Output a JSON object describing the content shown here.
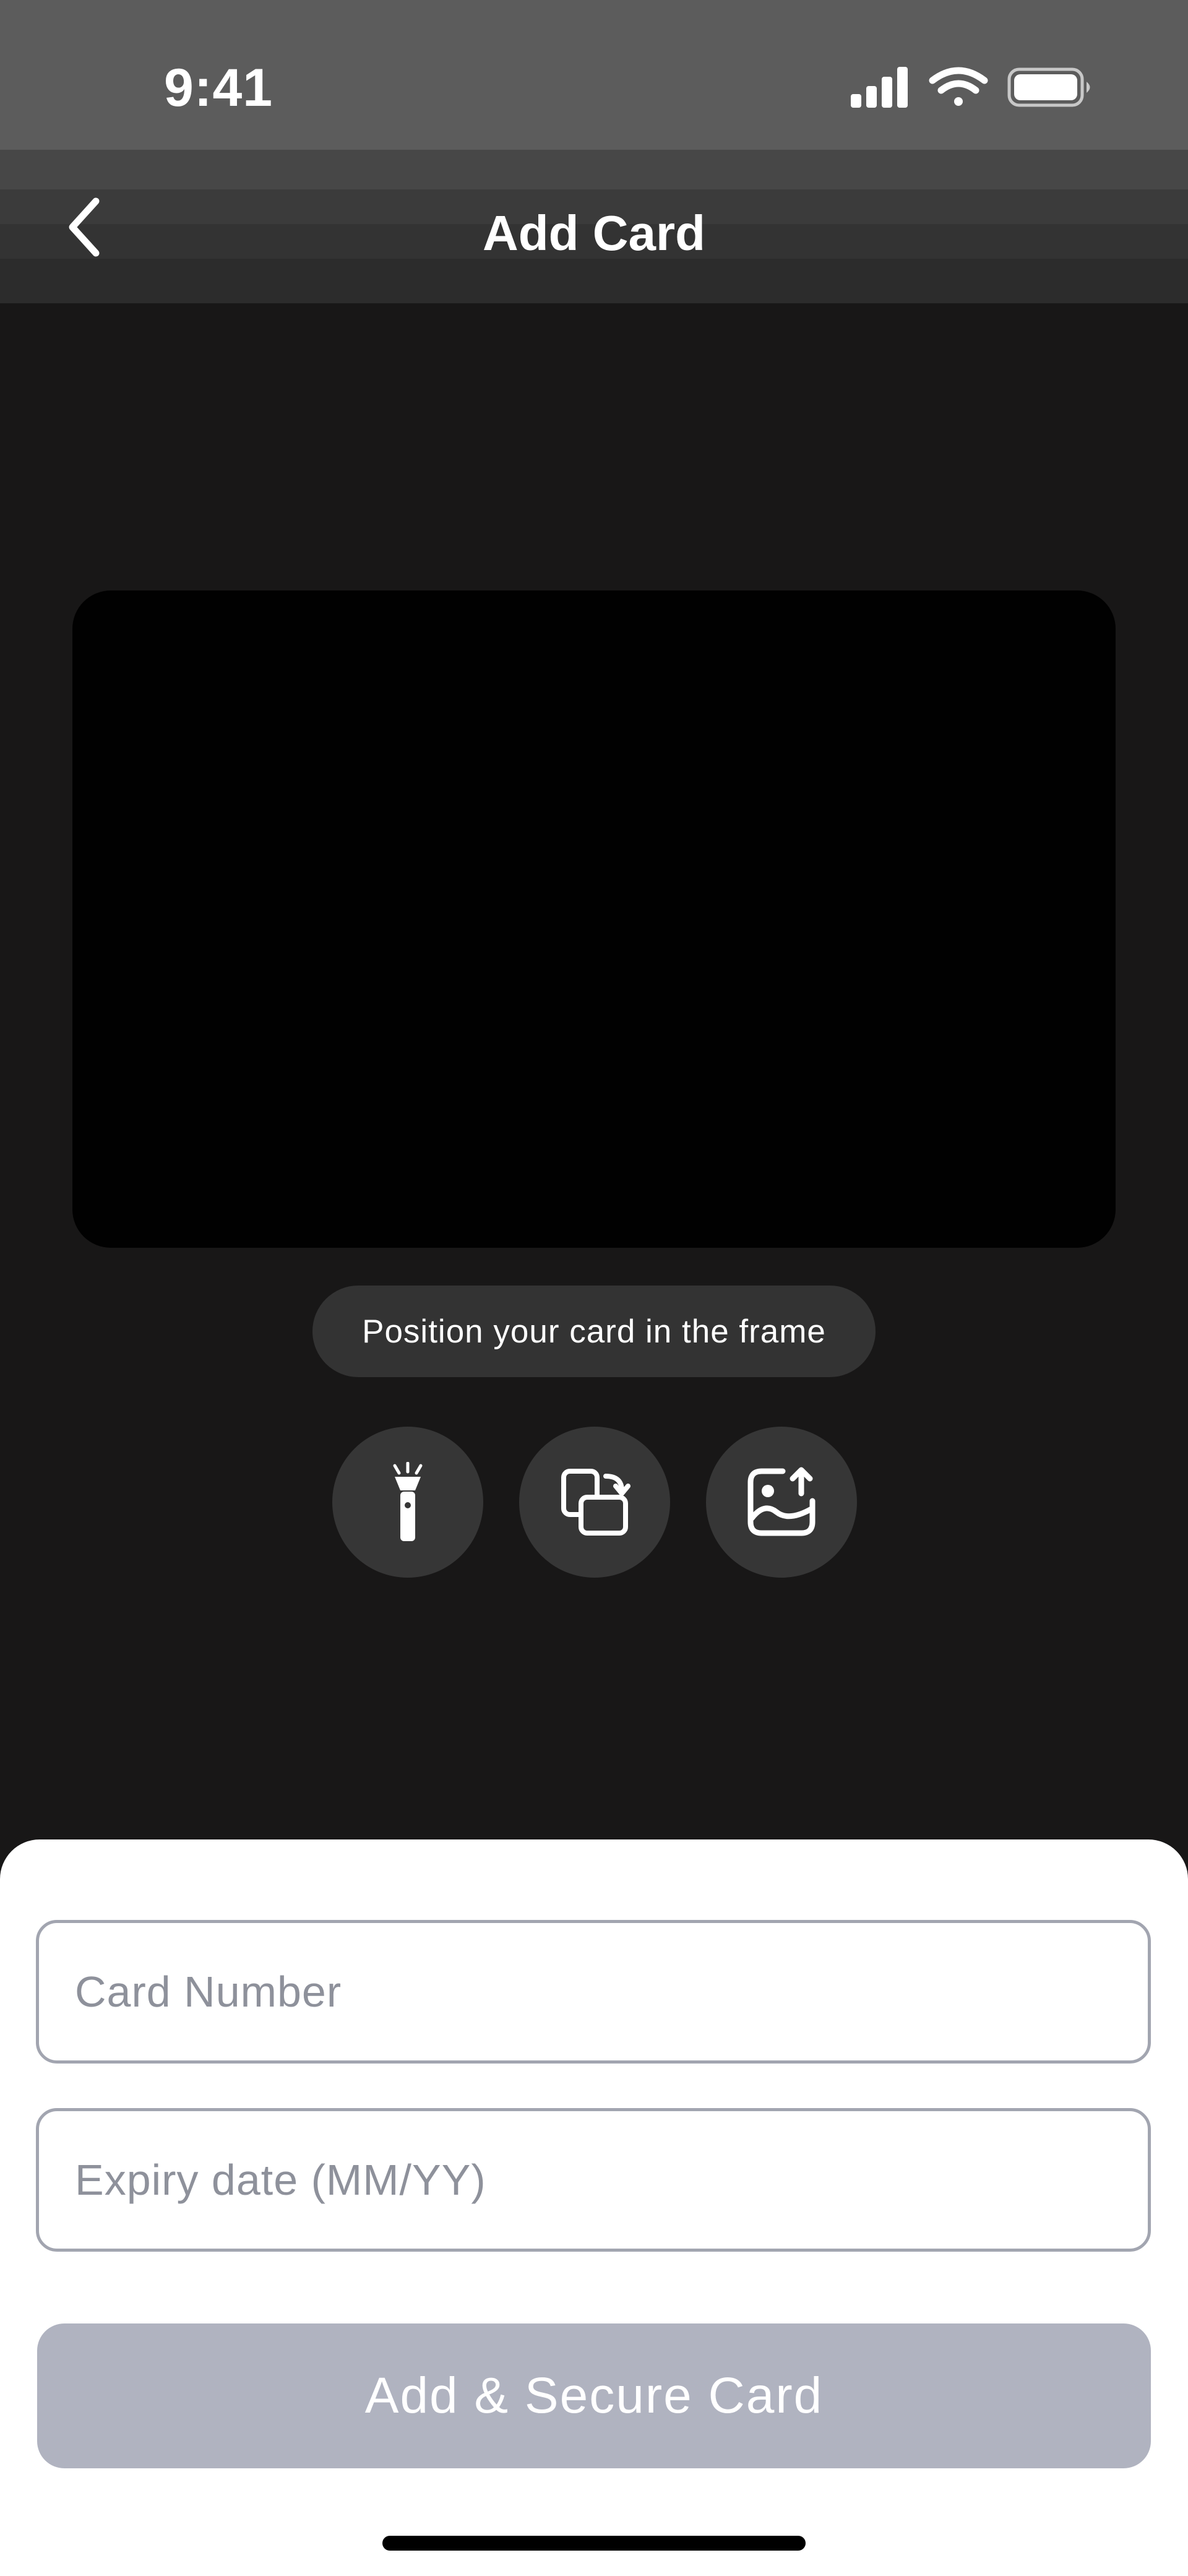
{
  "status_bar": {
    "time": "9:41",
    "icons": [
      "cellular-signal-icon",
      "wifi-icon",
      "battery-icon"
    ]
  },
  "nav": {
    "title": "Add Card",
    "back_icon": "chevron-left-icon"
  },
  "scanner": {
    "hint": "Position your card in the frame",
    "tools": [
      {
        "name": "flashlight-icon"
      },
      {
        "name": "switch-camera-icon"
      },
      {
        "name": "upload-image-icon"
      }
    ]
  },
  "form": {
    "card_number": {
      "value": "",
      "placeholder": "Card Number"
    },
    "expiry": {
      "value": "",
      "placeholder": "Expiry date (MM/YY)"
    },
    "submit_label": "Add & Secure Card"
  },
  "colors": {
    "background": "#181717",
    "status_bar": "#5c5c5c",
    "button_disabled": "#b0b3c0",
    "field_border": "#a2a5b0",
    "placeholder": "#8e919b"
  }
}
